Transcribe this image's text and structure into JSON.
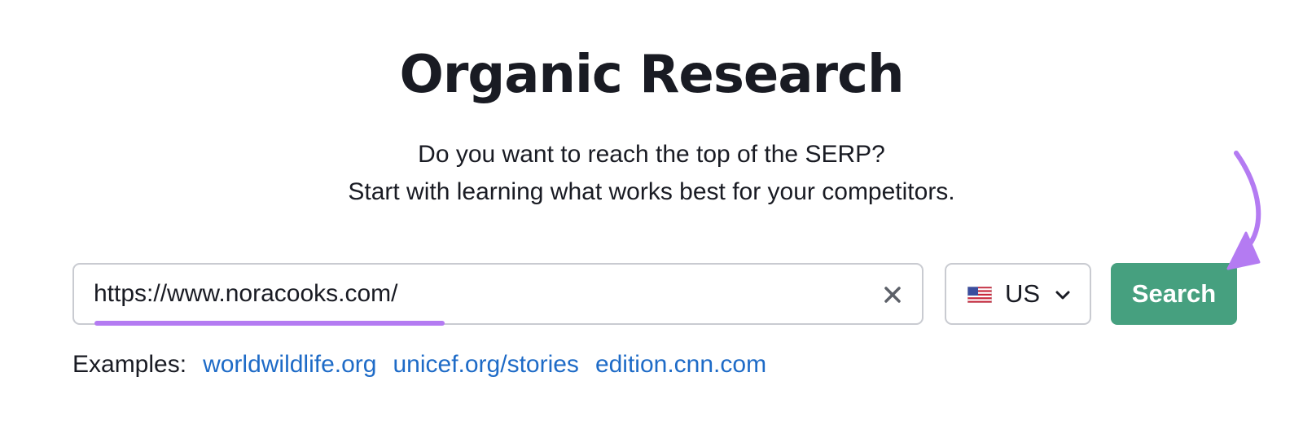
{
  "header": {
    "title": "Organic Research",
    "subtitle_line1": "Do you want to reach the top of the SERP?",
    "subtitle_line2": "Start with learning what works best for your competitors."
  },
  "search": {
    "value": "https://www.noracooks.com/",
    "clear_icon": "close-icon"
  },
  "country": {
    "selected": "US",
    "flag_icon": "us-flag-icon",
    "chevron_icon": "chevron-down-icon"
  },
  "search_button": {
    "label": "Search"
  },
  "examples": {
    "label": "Examples:",
    "links": [
      "worldwildlife.org",
      "unicef.org/stories",
      "edition.cnn.com"
    ]
  },
  "colors": {
    "accent_purple": "#b47bf2",
    "button_green": "#46a07f",
    "link_blue": "#1e6bc7"
  }
}
